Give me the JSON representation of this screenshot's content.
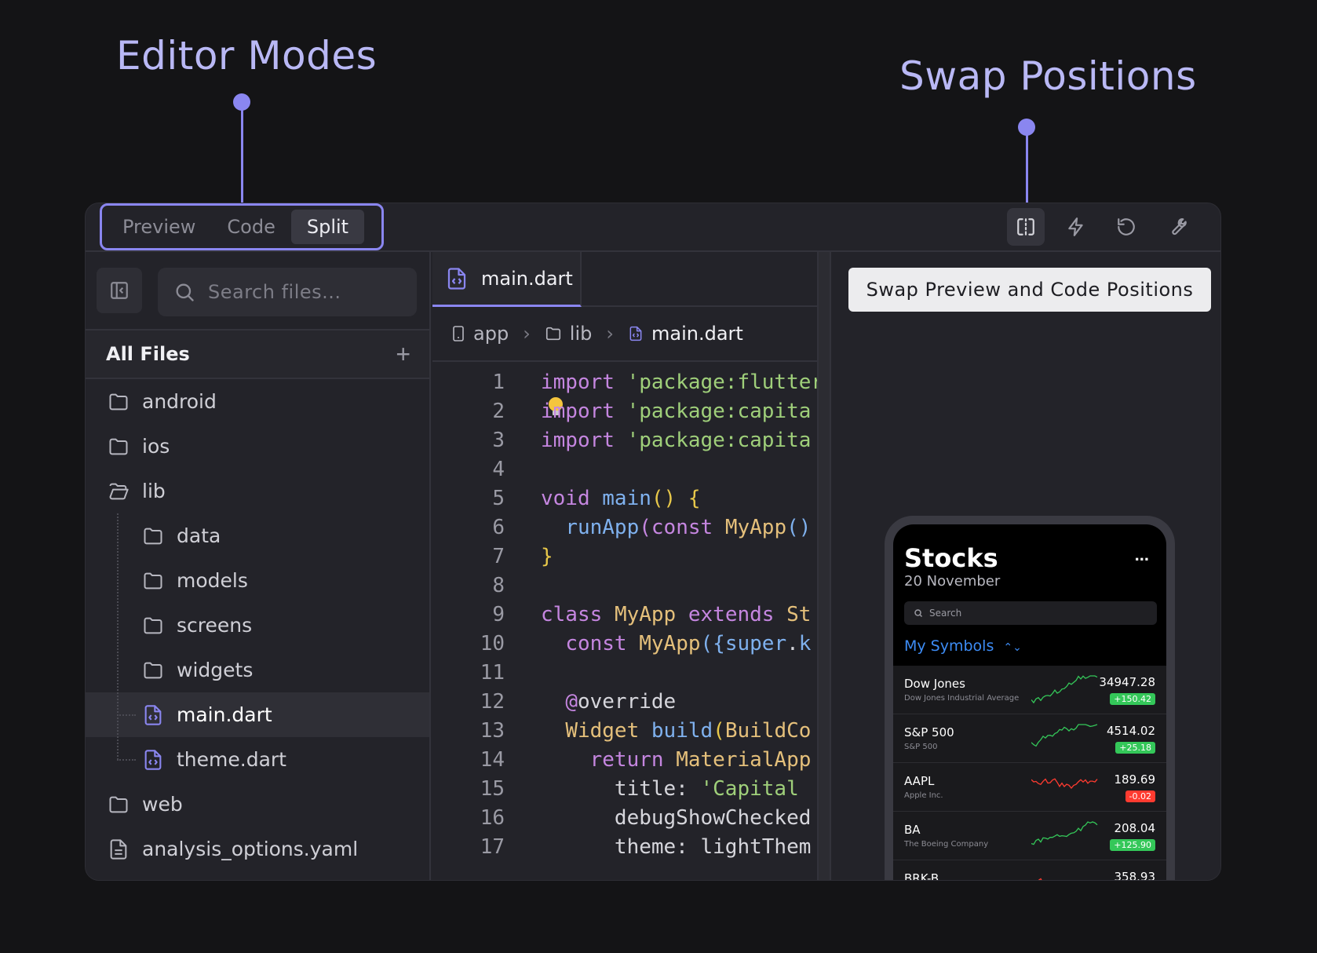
{
  "callouts": {
    "editor_modes": "Editor Modes",
    "swap_positions": "Swap Positions"
  },
  "modes": [
    {
      "label": "Preview",
      "active": false
    },
    {
      "label": "Code",
      "active": false
    },
    {
      "label": "Split",
      "active": true
    }
  ],
  "toolbar": {
    "icons": [
      "swap-icon",
      "lightning-icon",
      "reset-icon",
      "wrench-icon"
    ]
  },
  "sidebar": {
    "search_placeholder": "Search files...",
    "header": "All Files",
    "add": "+",
    "items": [
      {
        "label": "android",
        "type": "folder",
        "level": 0
      },
      {
        "label": "ios",
        "type": "folder",
        "level": 0
      },
      {
        "label": "lib",
        "type": "folder-open",
        "level": 0
      },
      {
        "label": "data",
        "type": "folder",
        "level": 1
      },
      {
        "label": "models",
        "type": "folder",
        "level": 1
      },
      {
        "label": "screens",
        "type": "folder",
        "level": 1
      },
      {
        "label": "widgets",
        "type": "folder",
        "level": 1
      },
      {
        "label": "main.dart",
        "type": "dart",
        "level": 1,
        "selected": true
      },
      {
        "label": "theme.dart",
        "type": "dart",
        "level": 1
      },
      {
        "label": "web",
        "type": "folder",
        "level": 0
      },
      {
        "label": "analysis_options.yaml",
        "type": "file",
        "level": 0
      }
    ]
  },
  "editor": {
    "tab": "main.dart",
    "breadcrumb": [
      "app",
      "lib",
      "main.dart"
    ],
    "lines": [
      {
        "n": "1",
        "tokens": [
          [
            "k",
            "import"
          ],
          [
            "w",
            " "
          ],
          [
            "s",
            "'package:flutter"
          ]
        ]
      },
      {
        "n": "2",
        "tokens": [
          [
            "k",
            "import"
          ],
          [
            "w",
            " "
          ],
          [
            "s",
            "'package:capita"
          ]
        ]
      },
      {
        "n": "3",
        "tokens": [
          [
            "k",
            "import"
          ],
          [
            "w",
            " "
          ],
          [
            "s",
            "'package:capita"
          ]
        ]
      },
      {
        "n": "4",
        "tokens": []
      },
      {
        "n": "5",
        "tokens": [
          [
            "k",
            "void"
          ],
          [
            "w",
            " "
          ],
          [
            "f",
            "main"
          ],
          [
            "p",
            "()"
          ],
          [
            "w",
            " "
          ],
          [
            "p",
            "{"
          ]
        ]
      },
      {
        "n": "6",
        "tokens": [
          [
            "w",
            "  "
          ],
          [
            "f",
            "runApp"
          ],
          [
            "k",
            "("
          ],
          [
            "k",
            "const"
          ],
          [
            "w",
            " "
          ],
          [
            "c",
            "MyApp"
          ],
          [
            "f",
            "()"
          ]
        ]
      },
      {
        "n": "7",
        "tokens": [
          [
            "p",
            "}"
          ]
        ]
      },
      {
        "n": "8",
        "tokens": []
      },
      {
        "n": "9",
        "tokens": [
          [
            "k",
            "class"
          ],
          [
            "w",
            " "
          ],
          [
            "c",
            "MyApp"
          ],
          [
            "w",
            " "
          ],
          [
            "k",
            "extends"
          ],
          [
            "w",
            " "
          ],
          [
            "c",
            "St"
          ]
        ]
      },
      {
        "n": "10",
        "tokens": [
          [
            "w",
            "  "
          ],
          [
            "k",
            "const"
          ],
          [
            "w",
            " "
          ],
          [
            "c",
            "MyApp"
          ],
          [
            "f",
            "({"
          ],
          [
            "f",
            "super"
          ],
          [
            "w",
            "."
          ],
          [
            "f",
            "k"
          ]
        ]
      },
      {
        "n": "11",
        "tokens": []
      },
      {
        "n": "12",
        "tokens": [
          [
            "w",
            "  "
          ],
          [
            "k",
            "@"
          ],
          [
            "w",
            "override"
          ]
        ]
      },
      {
        "n": "13",
        "tokens": [
          [
            "w",
            "  "
          ],
          [
            "c",
            "Widget"
          ],
          [
            "w",
            " "
          ],
          [
            "f",
            "build"
          ],
          [
            "p",
            "("
          ],
          [
            "c",
            "BuildCo"
          ]
        ]
      },
      {
        "n": "14",
        "tokens": [
          [
            "w",
            "    "
          ],
          [
            "k",
            "return"
          ],
          [
            "w",
            " "
          ],
          [
            "c",
            "MaterialApp"
          ]
        ]
      },
      {
        "n": "15",
        "tokens": [
          [
            "w",
            "      title: "
          ],
          [
            "s",
            "'Capital"
          ]
        ]
      },
      {
        "n": "16",
        "tokens": [
          [
            "w",
            "      debugShowChecked"
          ]
        ]
      },
      {
        "n": "17",
        "tokens": [
          [
            "w",
            "      theme: lightThem"
          ]
        ]
      }
    ]
  },
  "preview": {
    "tooltip": "Swap Preview and Code Positions",
    "app": {
      "title": "Stocks",
      "date": "20 November",
      "more": "...",
      "search": "Search",
      "symbols": "My Symbols",
      "stocks": [
        {
          "symbol": "Dow Jones",
          "name": "Dow Jones Industrial Average",
          "price": "34947.28",
          "change": "+150.42",
          "up": true
        },
        {
          "symbol": "S&P 500",
          "name": "S&P 500",
          "price": "4514.02",
          "change": "+25.18",
          "up": true
        },
        {
          "symbol": "AAPL",
          "name": "Apple Inc.",
          "price": "189.69",
          "change": "-0.02",
          "up": false
        },
        {
          "symbol": "BA",
          "name": "The Boeing Company",
          "price": "208.04",
          "change": "+125.90",
          "up": true
        },
        {
          "symbol": "BRK-B",
          "name": "",
          "price": "358.93",
          "change": "",
          "up": false
        }
      ]
    }
  },
  "colors": {
    "accent": "#8a86f0",
    "up": "#34c759",
    "down": "#ff3b30",
    "link": "#3d8cf5"
  }
}
